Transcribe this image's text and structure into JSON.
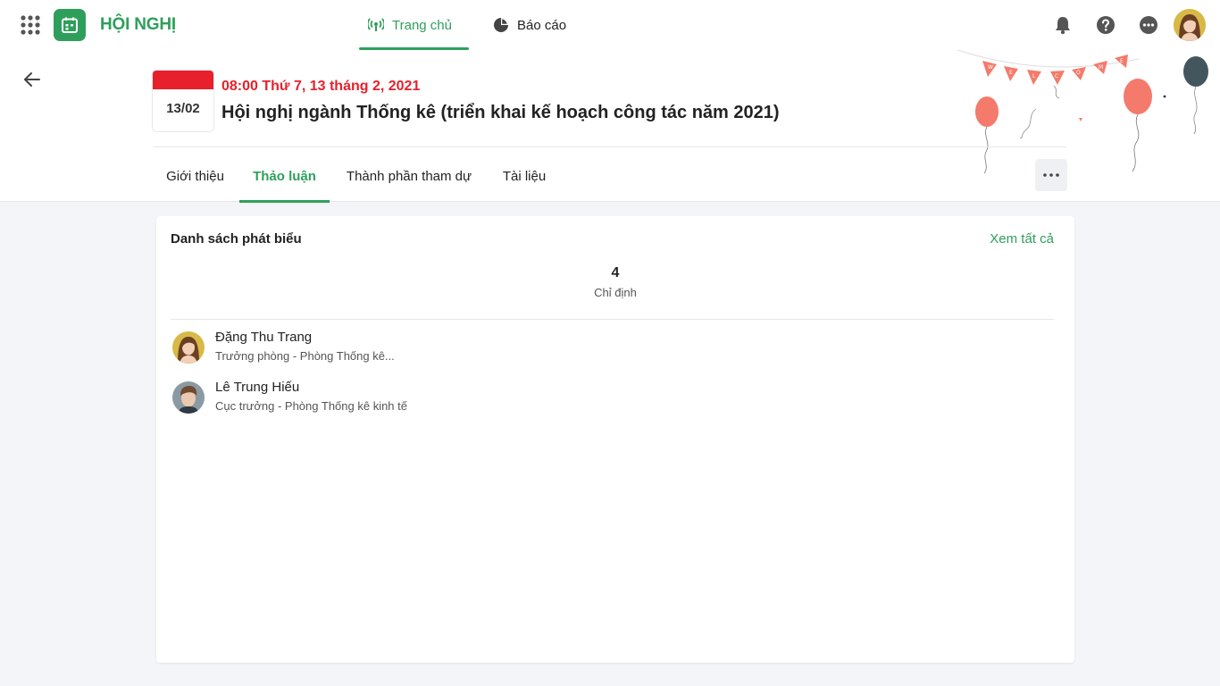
{
  "app": {
    "title": "HỘI NGHỊ"
  },
  "nav": {
    "tabs": [
      {
        "label": "Trang chủ",
        "icon": "broadcast-icon",
        "active": true
      },
      {
        "label": "Báo cáo",
        "icon": "pie-chart-icon",
        "active": false
      }
    ]
  },
  "topbar_icons": [
    "apps-grid-icon",
    "bell-icon",
    "help-icon",
    "more-icon"
  ],
  "event": {
    "date_badge": "13/02",
    "datetime": "08:00 Thứ 7, 13 tháng 2, 2021",
    "title": "Hội nghị ngành Thống kê (triển khai kế hoạch công tác năm 2021)"
  },
  "tabs": [
    {
      "label": "Giới thiệu",
      "active": false
    },
    {
      "label": "Thảo luận",
      "active": true
    },
    {
      "label": "Thành phần tham dự",
      "active": false
    },
    {
      "label": "Tài liệu",
      "active": false
    }
  ],
  "card": {
    "title": "Danh sách phát biểu",
    "view_all": "Xem tất cả",
    "stat": {
      "count": "4",
      "label": "Chỉ định"
    },
    "speakers": [
      {
        "name": "Đặng Thu Trang",
        "role": "Trưởng phòng - Phòng Thống kê..."
      },
      {
        "name": "Lê Trung Hiếu",
        "role": "Cục trưởng - Phòng Thống kê kinh tế"
      }
    ]
  },
  "colors": {
    "brand": "#2e9f5b",
    "accent_red": "#e8202c",
    "background": "#f4f5f9"
  }
}
